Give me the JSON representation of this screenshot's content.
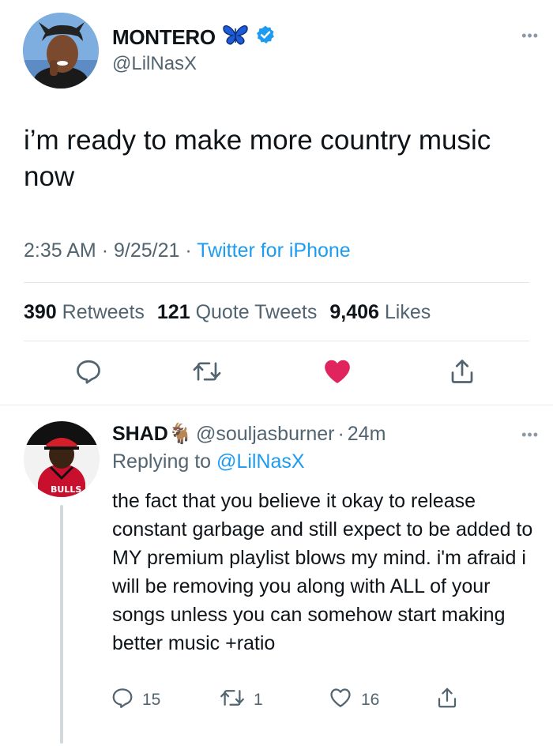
{
  "main_tweet": {
    "author_name": "MONTERO",
    "author_handle": "@LilNasX",
    "text": "i’m ready to make more country music now",
    "time": "2:35 AM",
    "date": "9/25/21",
    "source": "Twitter for iPhone",
    "stats": {
      "retweets_count": "390",
      "retweets_label": "Retweets",
      "quotes_count": "121",
      "quotes_label": "Quote Tweets",
      "likes_count": "9,406",
      "likes_label": "Likes"
    },
    "liked": true,
    "icons": [
      "butterfly-icon",
      "verified-badge-icon",
      "more-icon",
      "reply-icon",
      "retweet-icon",
      "heart-filled-icon",
      "share-icon"
    ]
  },
  "reply_tweet": {
    "author_name": "SHAD",
    "author_emoji": "🐐",
    "author_handle": "@souljasburner",
    "time_ago": "24m",
    "replying_prefix": "Replying to",
    "replying_to": "@LilNasX",
    "text": "the fact that you believe it okay to release constant garbage and still expect to be added to MY premium playlist blows my mind. i'm afraid i will be removing you along with ALL of your songs unless you can somehow start making better music +ratio",
    "reply_count": "15",
    "retweet_count": "1",
    "like_count": "16"
  },
  "colors": {
    "link_blue": "#1d9bf0",
    "secondary_gray": "#536471",
    "like_red": "#e0245e",
    "divider": "#e7eaec"
  }
}
